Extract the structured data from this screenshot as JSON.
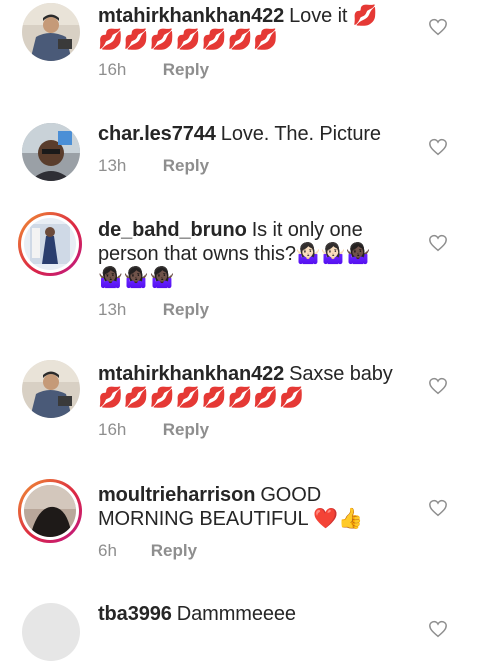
{
  "comments": [
    {
      "username": "mtahirkhankhan422",
      "text": "Love it",
      "emoji_inline": "💋",
      "emoji_line": "💋💋💋💋💋💋💋",
      "time": "16h",
      "reply": "Reply"
    },
    {
      "username": "char.les7744",
      "text": "Love. The. Picture",
      "time": "13h",
      "reply": "Reply"
    },
    {
      "username": "de_bahd_bruno",
      "text": "Is it only one person that owns this?",
      "emoji_inline": "🤷🏻‍♀️🤷🏻‍♀️🤷🏿‍♀️",
      "emoji_line": "🤷🏿‍♀️🤷🏿‍♀️🤷🏿‍♀️",
      "time": "13h",
      "reply": "Reply"
    },
    {
      "username": "mtahirkhankhan422",
      "text": "Saxse baby",
      "emoji_line": "💋💋💋💋💋💋💋💋",
      "time": "16h",
      "reply": "Reply"
    },
    {
      "username": "moultrieharrison",
      "text": "GOOD MORNING BEAUTIFUL",
      "emoji_inline": "❤️👍",
      "time": "6h",
      "reply": "Reply"
    },
    {
      "username": "tba3996",
      "text": "Dammmeeee"
    }
  ],
  "colors": {
    "text": "#262626",
    "meta": "#8e8e8e",
    "heart_outline": "#8e8e8e",
    "story_ring_start": "#f09433",
    "story_ring_end": "#bc1888"
  },
  "icons": {
    "like": "heart-outline-icon"
  }
}
